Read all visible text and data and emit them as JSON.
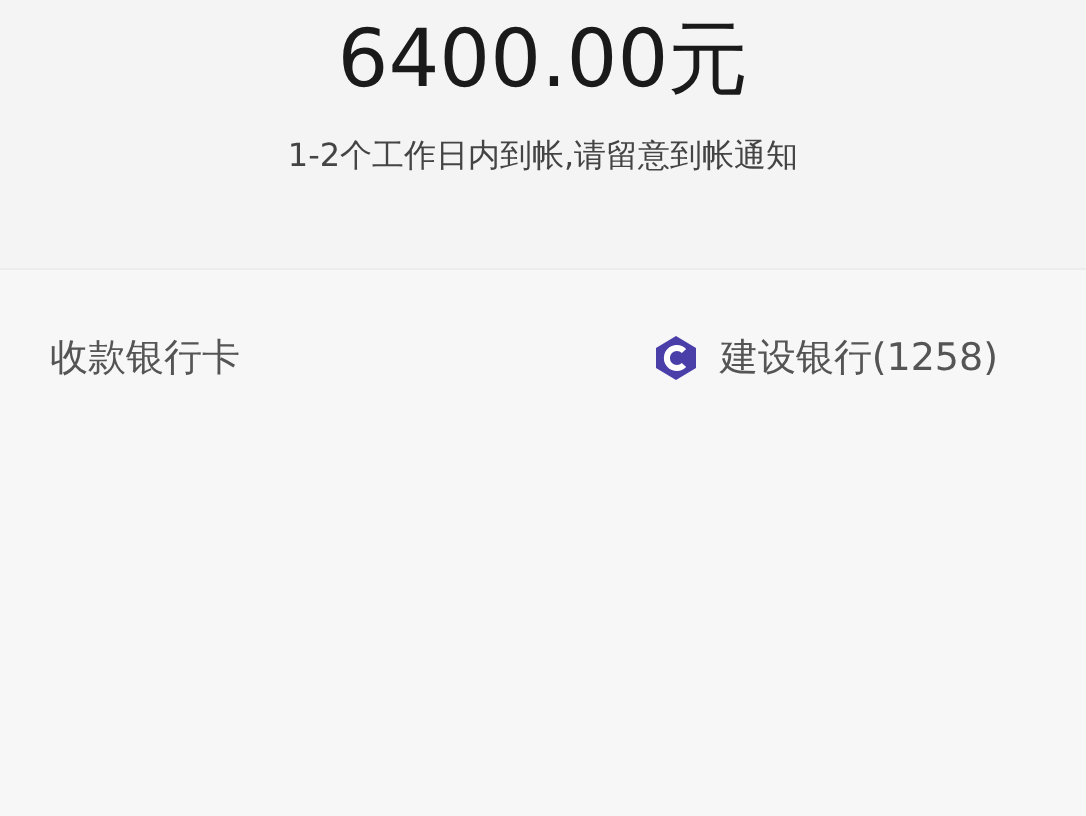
{
  "amount": "6400.00元",
  "notice": "1-2个工作日内到帐,请留意到帐通知",
  "rows": [
    {
      "label": "收款银行卡",
      "value": "建设银行(1258)"
    }
  ]
}
